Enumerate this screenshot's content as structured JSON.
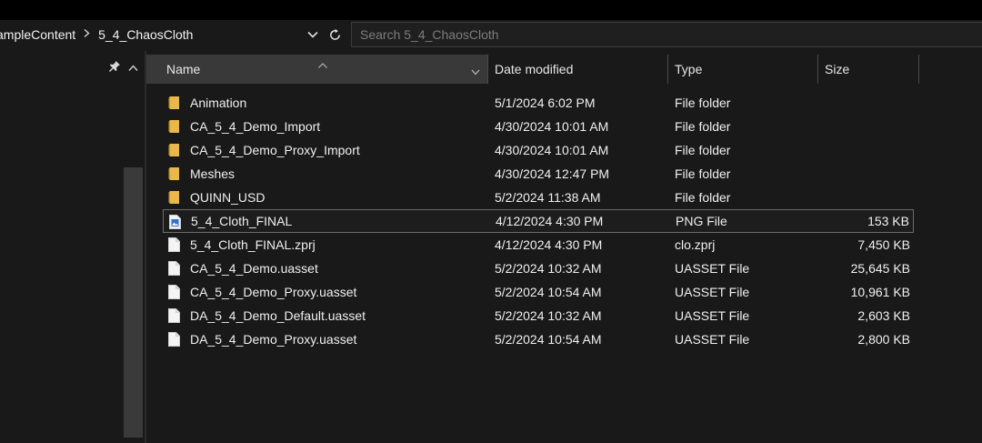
{
  "breadcrumb": {
    "parent": "ampleContent",
    "current": "5_4_ChaosCloth"
  },
  "search": {
    "placeholder": "Search 5_4_ChaosCloth"
  },
  "columns": {
    "name": "Name",
    "date": "Date modified",
    "type": "Type",
    "size": "Size"
  },
  "files": [
    {
      "name": "Animation",
      "date": "5/1/2024 6:02 PM",
      "type": "File folder",
      "size": "",
      "icon": "folder-icon"
    },
    {
      "name": "CA_5_4_Demo_Import",
      "date": "4/30/2024 10:01 AM",
      "type": "File folder",
      "size": "",
      "icon": "folder-icon"
    },
    {
      "name": "CA_5_4_Demo_Proxy_Import",
      "date": "4/30/2024 10:01 AM",
      "type": "File folder",
      "size": "",
      "icon": "folder-icon"
    },
    {
      "name": "Meshes",
      "date": "4/30/2024 12:47 PM",
      "type": "File folder",
      "size": "",
      "icon": "folder-icon"
    },
    {
      "name": "QUINN_USD",
      "date": "5/2/2024 11:38 AM",
      "type": "File folder",
      "size": "",
      "icon": "folder-icon"
    },
    {
      "name": "5_4_Cloth_FINAL",
      "date": "4/12/2024 4:30 PM",
      "type": "PNG File",
      "size": "153 KB",
      "icon": "image-file-icon",
      "selected": true
    },
    {
      "name": "5_4_Cloth_FINAL.zprj",
      "date": "4/12/2024 4:30 PM",
      "type": "clo.zprj",
      "size": "7,450 KB",
      "icon": "file-icon"
    },
    {
      "name": "CA_5_4_Demo.uasset",
      "date": "5/2/2024 10:32 AM",
      "type": "UASSET File",
      "size": "25,645 KB",
      "icon": "file-icon"
    },
    {
      "name": "CA_5_4_Demo_Proxy.uasset",
      "date": "5/2/2024 10:54 AM",
      "type": "UASSET File",
      "size": "10,961 KB",
      "icon": "file-icon"
    },
    {
      "name": "DA_5_4_Demo_Default.uasset",
      "date": "5/2/2024 10:32 AM",
      "type": "UASSET File",
      "size": "2,603 KB",
      "icon": "file-icon"
    },
    {
      "name": "DA_5_4_Demo_Proxy.uasset",
      "date": "5/2/2024 10:54 AM",
      "type": "UASSET File",
      "size": "2,800 KB",
      "icon": "file-icon"
    }
  ],
  "colors": {
    "folder": "#e8b84a",
    "background": "#191919",
    "header_active": "#393939"
  }
}
